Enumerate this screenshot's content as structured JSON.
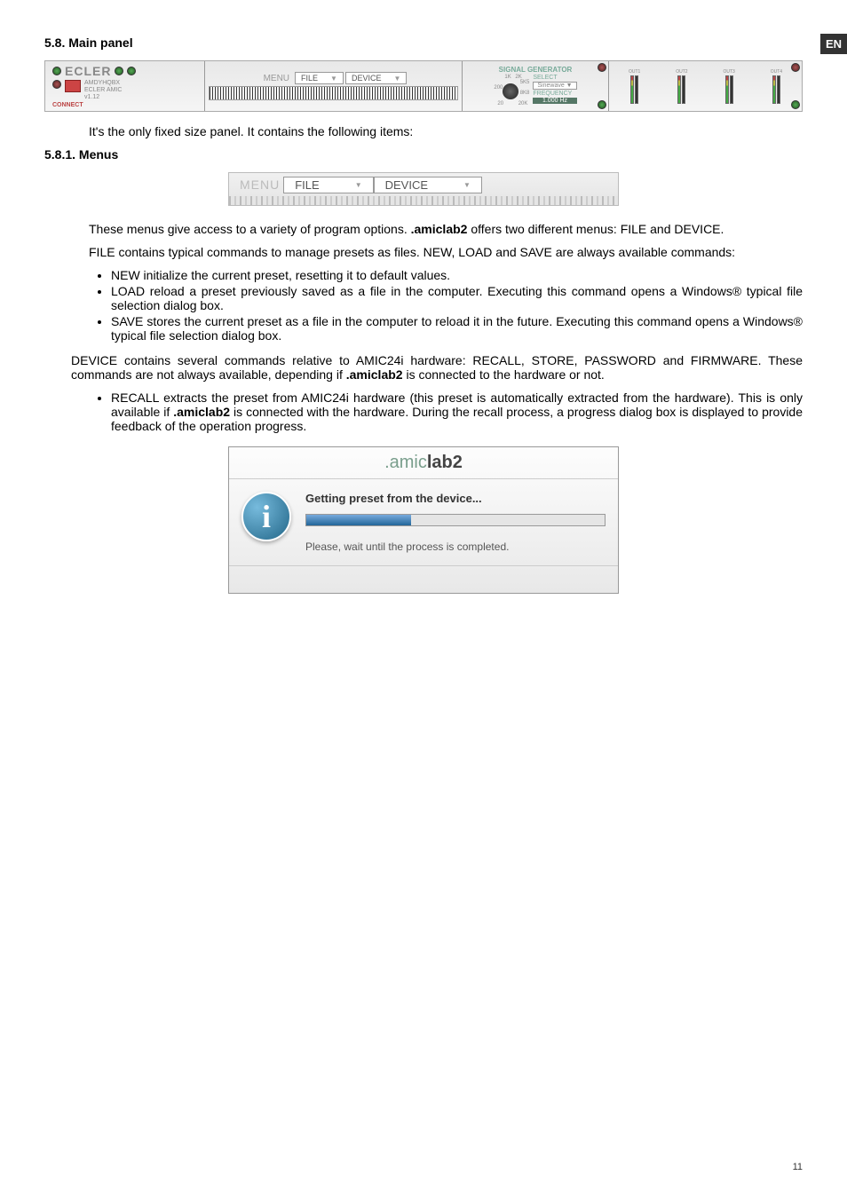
{
  "badge": "EN",
  "section581": "5.8. Main panel",
  "panel": {
    "logo": "ECLER",
    "device_model": "AMDYHQBX",
    "device_line2": "ECLER AMIC",
    "version": "v1.12",
    "connect": "CONNECT",
    "menu_label": "MENU",
    "file_label": "FILE",
    "device_label": "DEVICE",
    "siggen_title": "SIGNAL GENERATOR",
    "select_label": "SELECT",
    "select_value": "Sinewave",
    "freq_label": "FREQUENCY",
    "freq_value": "1.000 Hz",
    "dial_1k": "1K",
    "dial_2k": "2K",
    "dial_5k": "5K5",
    "dial_8k": "8K8",
    "dial_200": "200",
    "dial_20": "20",
    "dial_20k": "20K",
    "out1": "OUT1",
    "out2": "OUT2",
    "out3": "OUT3",
    "out4": "OUT4"
  },
  "p_intro": "It's the only fixed size panel. It contains the following items:",
  "section5811": "5.8.1. Menus",
  "menus_img": {
    "menu": "MENU",
    "file": "FILE",
    "device": "DEVICE"
  },
  "p_menus": "These menus give access to a variety of program options. ",
  "amiclab2": ".amiclab2",
  "p_menus2": " offers two different menus: FILE and DEVICE.",
  "p_file": "FILE contains typical commands to manage presets as files. NEW, LOAD and SAVE are always available commands:",
  "li_new": "NEW initialize the current preset, resetting it to default values.",
  "li_load": "LOAD reload a preset previously saved as a file in the computer. Executing this command opens a Windows® typical file selection dialog box.",
  "li_save": "SAVE stores the current preset as a file in the computer to reload it in the future. Executing this command opens a Windows® typical file selection dialog box.",
  "p_device1": "DEVICE contains several commands relative to AMIC24i hardware: RECALL, STORE, PASSWORD and FIRMWARE. These commands are not always available, depending if ",
  "p_device2": " is connected to the hardware or not.",
  "li_recall1": "RECALL extracts the preset from AMIC24i hardware (this preset is automatically extracted from the hardware). This is only available if ",
  "li_recall2": " is connected with the hardware. During the recall process, a progress dialog box is displayed to provide feedback of the operation progress.",
  "dialog": {
    "title1": ".amic",
    "title2": "lab",
    "title3": "2",
    "msg": "Getting preset from the device...",
    "sub": "Please, wait until the process is completed."
  },
  "page_num": "11"
}
